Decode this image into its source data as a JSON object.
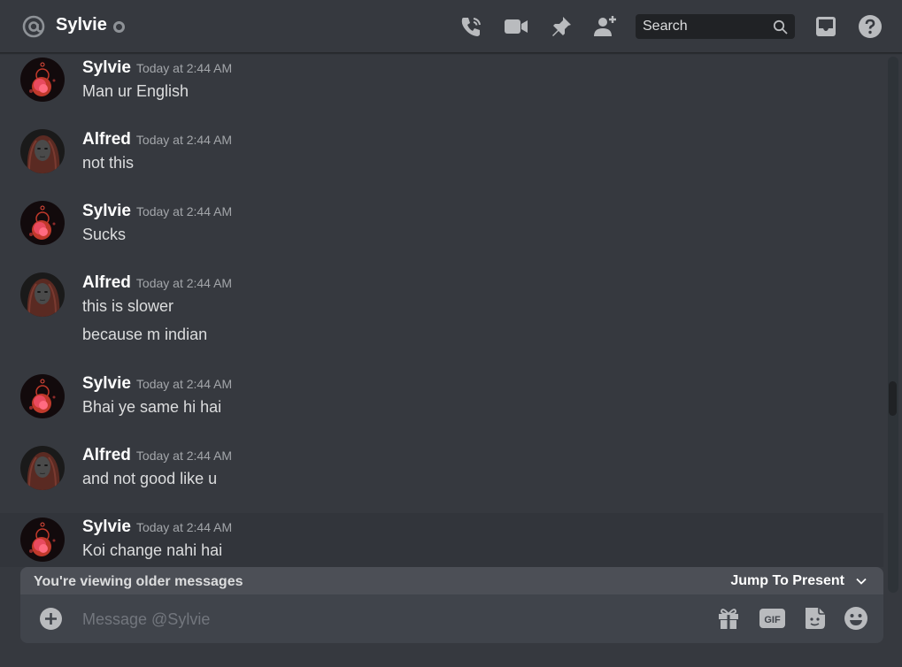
{
  "header": {
    "channel_name": "Sylvie",
    "search_placeholder": "Search",
    "icons": [
      "at-icon",
      "phone-call-icon",
      "video-call-icon",
      "pin-icon",
      "add-friend-icon",
      "search-icon",
      "inbox-icon",
      "help-icon"
    ]
  },
  "messages": [
    {
      "author": "Sylvie",
      "time": "Today at 2:44 AM",
      "lines": [
        "Man ur English"
      ]
    },
    {
      "author": "Alfred",
      "time": "Today at 2:44 AM",
      "lines": [
        "not this"
      ]
    },
    {
      "author": "Sylvie",
      "time": "Today at 2:44 AM",
      "lines": [
        "Sucks"
      ]
    },
    {
      "author": "Alfred",
      "time": "Today at 2:44 AM",
      "lines": [
        "this is slower",
        "because m indian"
      ]
    },
    {
      "author": "Sylvie",
      "time": "Today at 2:44 AM",
      "lines": [
        "Bhai ye same hi hai"
      ]
    },
    {
      "author": "Alfred",
      "time": "Today at 2:44 AM",
      "lines": [
        "and not good like u"
      ]
    },
    {
      "author": "Sylvie",
      "time": "Today at 2:44 AM",
      "lines": [
        "Koi change nahi hai"
      ]
    }
  ],
  "older_bar": {
    "text": "You're viewing older messages",
    "jump_label": "Jump To Present"
  },
  "composer": {
    "placeholder": "Message @Sylvie",
    "icons": [
      "add-attachment-icon",
      "gift-icon",
      "gif-icon",
      "sticker-icon",
      "emoji-icon"
    ]
  },
  "colors": {
    "background": "#36393f",
    "header_text": "#ffffff",
    "timestamp": "#a3a6aa",
    "message_text": "#dcddde",
    "composer_bg": "#40444b",
    "older_bar_bg": "#4c4f56"
  }
}
